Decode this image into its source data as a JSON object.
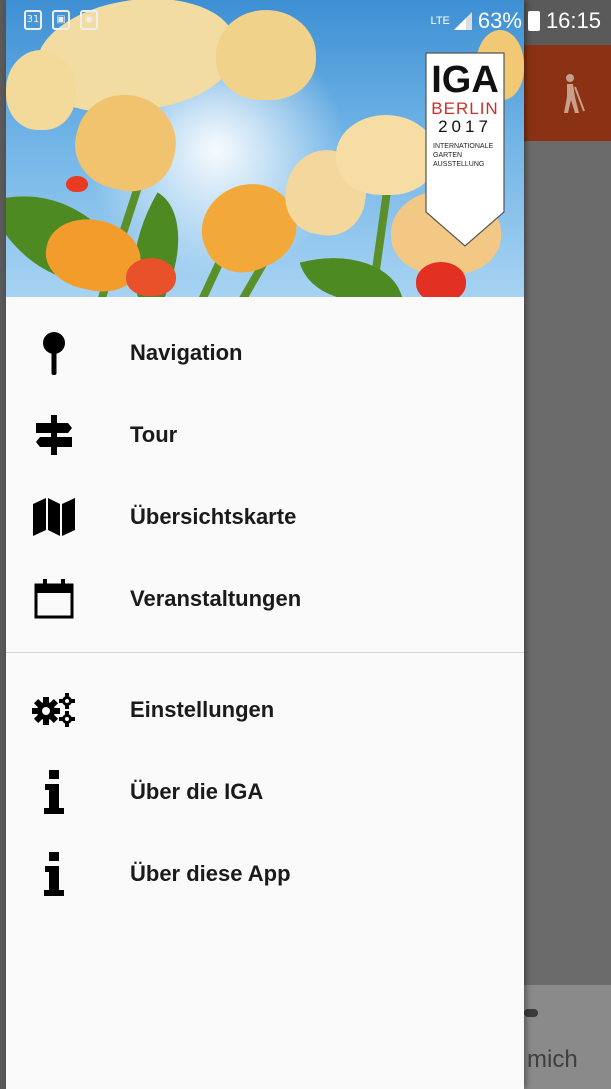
{
  "status_bar": {
    "left_icons": [
      "calendar-31-icon",
      "gallery-icon",
      "camera-icon"
    ],
    "calendar_day": "31",
    "network": "LTE",
    "battery": "63%",
    "time": "16:15"
  },
  "header": {
    "logo_title": "IGA",
    "logo_city": "BERLIN",
    "logo_year": "2017",
    "logo_line1": "INTERNATIONALE",
    "logo_line2": "GARTEN",
    "logo_line3": "AUSSTELLUNG"
  },
  "menu": {
    "primary": [
      {
        "label": "Navigation",
        "icon": "map-pin-icon"
      },
      {
        "label": "Tour",
        "icon": "signpost-icon"
      },
      {
        "label": "Übersichtskarte",
        "icon": "folded-map-icon"
      },
      {
        "label": "Veranstaltungen",
        "icon": "calendar-icon"
      }
    ],
    "secondary": [
      {
        "label": "Einstellungen",
        "icon": "gears-icon"
      },
      {
        "label": "Über die IGA",
        "icon": "info-icon"
      },
      {
        "label": "Über diese App",
        "icon": "info-icon"
      }
    ]
  },
  "background": {
    "bottom_text": "mich"
  },
  "colors": {
    "toolbar": "#8a3213",
    "logo_red": "#c8322a",
    "drawer_bg": "#fafafa"
  }
}
